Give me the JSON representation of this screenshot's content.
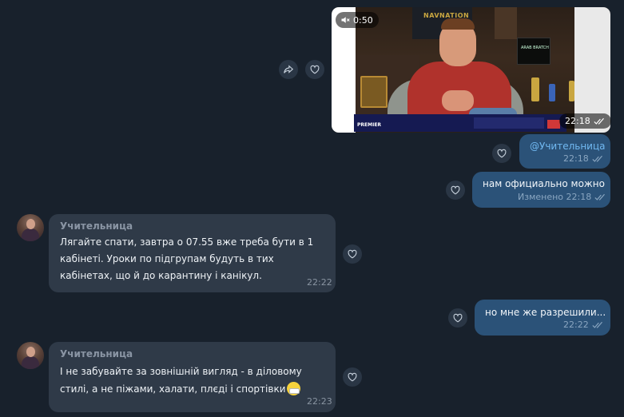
{
  "video_message": {
    "duration": "0:50",
    "time": "22:18",
    "poster_text": "NAVNATION",
    "ticker_text": "PREMIER",
    "monitor_text": "ARAB BRATCH"
  },
  "messages_out": [
    {
      "text": "@Учительница",
      "time": "22:18"
    },
    {
      "text": "нам официально можно",
      "edited": "Изменено",
      "time": "22:18"
    },
    {
      "text": "но мне же разрешили...",
      "time": "22:22"
    }
  ],
  "messages_in": [
    {
      "sender": "Учительница",
      "text": "Лягайте спати, завтра о 07.55 вже треба бути в 1 кабінеті. Уроки по підгрупам будуть в тих кабінетах, що й до карантину і канікул.",
      "time": "22:22"
    },
    {
      "sender": "Учительница",
      "text": "І не забувайте за зовнішній вигляд - в діловому стилі, а не піжами, халати, плєді і спортівки",
      "time": "22:23"
    }
  ],
  "icons": [
    "mute-icon",
    "double-check-icon",
    "share-icon",
    "heart-icon"
  ],
  "colors": {
    "background": "#18212c",
    "outgoing_bubble": "#2b5278",
    "incoming_bubble": "#2f3a48",
    "mention": "#71b9f2"
  }
}
